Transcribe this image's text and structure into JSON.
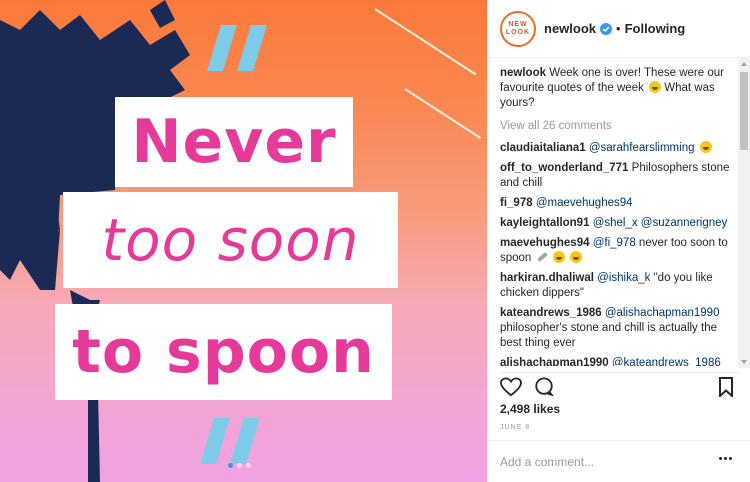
{
  "post": {
    "quote_lines": [
      "Never",
      "too soon",
      "to spoon"
    ],
    "carousel_total": 3,
    "carousel_active": 1
  },
  "header": {
    "avatar_line1": "NEW",
    "avatar_line2": "LOOK",
    "username": "newlook",
    "separator": "•",
    "follow_status": "Following"
  },
  "caption": {
    "user": "newlook",
    "text": "Week one is over! These were our favourite quotes of the week",
    "text_tail": "What was yours?"
  },
  "view_all": "View all 26 comments",
  "comments": [
    {
      "user": "claudiaitaliana1",
      "mention": "@sarahfearslimming",
      "text": ""
    },
    {
      "user": "off_to_wonderland_771",
      "mention": "",
      "text": "Philosophers stone and chill"
    },
    {
      "user": "fi_978",
      "mention": "@maevehughes94",
      "text": ""
    },
    {
      "user": "kayleightallon91",
      "mention": "@shel_x @suzannerigney",
      "text": ""
    },
    {
      "user": "maevehughes94",
      "mention": "@fi_978",
      "text": "never too soon to spoon"
    },
    {
      "user": "harkiran.dhaliwal",
      "mention": "@ishika_k",
      "text": "\"do you like chicken dippers\""
    },
    {
      "user": "kateandrews_1986",
      "mention": "@alishachapman1990",
      "text": "philosopher's stone and chill is actually the best thing ever"
    },
    {
      "user": "alishachapman1990",
      "mention": "@kateandrews_1986",
      "text": ""
    }
  ],
  "likes": "2,498 likes",
  "date": "JUNE 8",
  "add_comment": {
    "placeholder": "Add a comment..."
  },
  "colors": {
    "brand_pink": "#e63a9a",
    "link": "#003569",
    "verified": "#3897f0",
    "avatar_ring": "#ef6a2e"
  }
}
